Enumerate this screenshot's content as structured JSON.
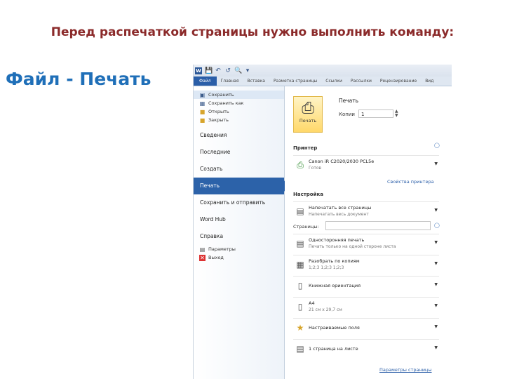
{
  "slide": {
    "title": "Перед распечаткой страницы нужно выполнить команду:",
    "caption": "Файл - Печать"
  },
  "colors": {
    "title": "#8b2a2a",
    "caption": "#1f6fb8",
    "accent": "#2c62a9"
  },
  "word": {
    "quick_access": {
      "logo": "W",
      "icons": [
        "save-icon",
        "undo-icon",
        "redo-icon",
        "print-preview-icon",
        "customize-icon"
      ]
    },
    "tabs": [
      {
        "label": "Файл",
        "selected": true
      },
      {
        "label": "Главная"
      },
      {
        "label": "Вставка"
      },
      {
        "label": "Разметка страницы"
      },
      {
        "label": "Ссылки"
      },
      {
        "label": "Рассылки"
      },
      {
        "label": "Рецензирование"
      },
      {
        "label": "Вид"
      }
    ],
    "backstage": {
      "commands": [
        {
          "label": "Сохранить",
          "icon": "save-icon"
        },
        {
          "label": "Сохранить как",
          "icon": "save-as-icon"
        },
        {
          "label": "Открыть",
          "icon": "open-folder-icon"
        },
        {
          "label": "Закрыть",
          "icon": "close-folder-icon"
        }
      ],
      "nav": [
        {
          "label": "Сведения"
        },
        {
          "label": "Последние"
        },
        {
          "label": "Создать"
        },
        {
          "label": "Печать",
          "active": true
        },
        {
          "label": "Сохранить и отправить"
        },
        {
          "label": "Word Hub"
        },
        {
          "label": "Справка"
        }
      ],
      "bottom": [
        {
          "label": "Параметры",
          "icon": "options-icon"
        },
        {
          "label": "Выход",
          "icon": "exit-icon"
        }
      ]
    },
    "print_pane": {
      "print_button_label": "Печать",
      "header": "Печать",
      "copies_label": "Копии",
      "copies_value": "1",
      "printer_header": "Принтер",
      "printer_name": "Canon iR C2020/2030 PCL5e",
      "printer_status": "Готов",
      "printer_properties_link": "Свойства принтера",
      "settings_header": "Настройка",
      "print_range": {
        "title": "Напечатать все страницы",
        "subtitle": "Напечатать весь документ"
      },
      "pages_label": "Страницы:",
      "pages_value": "",
      "sides": {
        "title": "Односторонняя печать",
        "subtitle": "Печать только на одной стороне листа"
      },
      "collate": {
        "title": "Разобрать по копиям",
        "subtitle": "1;2;3   1;2;3   1;2;3"
      },
      "orientation": {
        "title": "Книжная ориентация",
        "subtitle": ""
      },
      "paper": {
        "title": "A4",
        "subtitle": "21 см x 29,7 см"
      },
      "margins": {
        "title": "Настраиваемые поля",
        "subtitle": ""
      },
      "per_sheet": {
        "title": "1 страница на листе",
        "subtitle": ""
      },
      "page_setup_link": "Параметры страницы"
    }
  }
}
